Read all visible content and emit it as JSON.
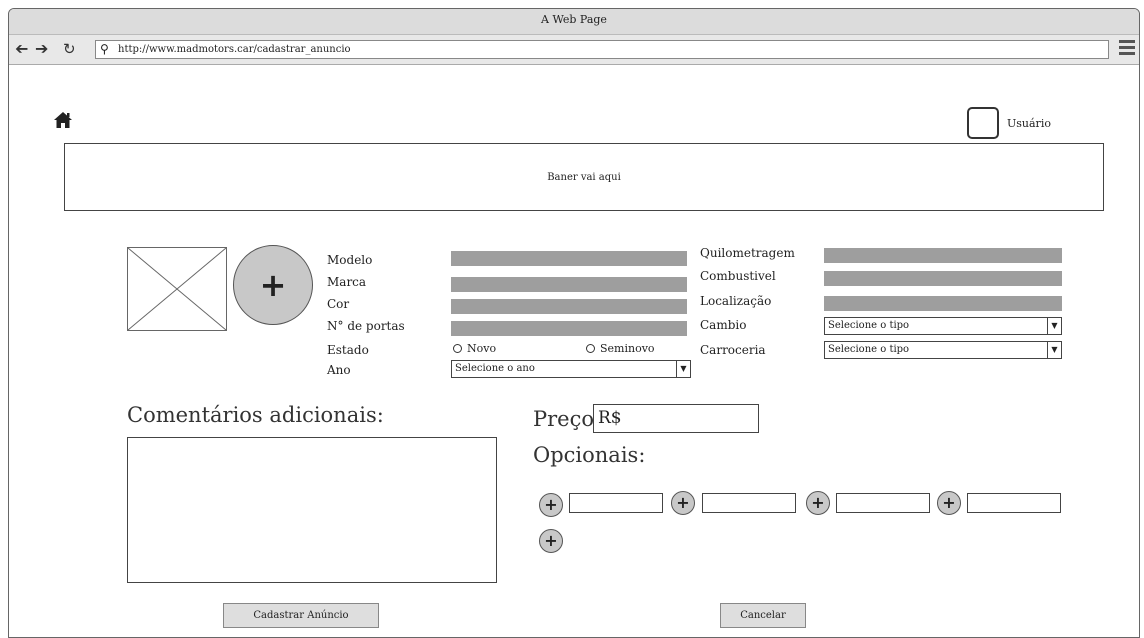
{
  "window": {
    "title": "A Web Page"
  },
  "browser": {
    "url": "http://www.madmotors.car/cadastrar_anuncio",
    "back_icon": "back-arrow-icon",
    "forward_icon": "forward-arrow-icon",
    "reload_icon": "reload-icon",
    "menu_icon": "hamburger-menu-icon"
  },
  "header": {
    "home_icon": "home-icon",
    "user_label": "Usuário"
  },
  "banner": {
    "text": "Baner vai aqui"
  },
  "form": {
    "labels": {
      "modelo": "Modelo",
      "marca": "Marca",
      "cor": "Cor",
      "portas": "N° de portas",
      "estado": "Estado",
      "ano": "Ano",
      "quilometragem": "Quilometragem",
      "combustivel": "Combustivel",
      "localizacao": "Localização",
      "cambio": "Cambio",
      "carroceria": "Carroceria"
    },
    "estado_options": {
      "novo": "Novo",
      "seminovo": "Seminovo"
    },
    "ano_select": "Selecione o ano",
    "cambio_select": "Selecione o tipo",
    "carroceria_select": "Selecione o tipo"
  },
  "comments": {
    "title": "Comentários adicionais:"
  },
  "price": {
    "label": "Preço",
    "value": "R$"
  },
  "opcionais": {
    "title": "Opcionais:",
    "plus_symbol": "+"
  },
  "actions": {
    "submit": "Cadastrar Anúncio",
    "cancel": "Cancelar"
  }
}
